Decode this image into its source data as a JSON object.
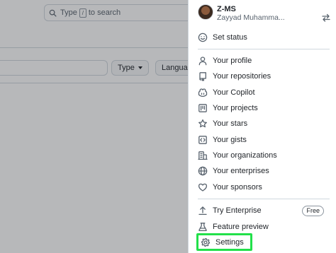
{
  "background": {
    "search_text_before": "Type",
    "search_key": "/",
    "search_text_after": "to search",
    "type_button_label": "Type",
    "language_button_label": "Languag"
  },
  "account_menu": {
    "username": "Z-MS",
    "full_name": "Zayyad Muhamma...",
    "switch_icon": "arrow-switch-icon",
    "items": [
      {
        "label": "Set status",
        "icon": "smiley-icon"
      },
      {
        "label": "Your profile",
        "icon": "person-icon"
      },
      {
        "label": "Your repositories",
        "icon": "repo-icon"
      },
      {
        "label": "Your Copilot",
        "icon": "copilot-icon"
      },
      {
        "label": "Your projects",
        "icon": "project-icon"
      },
      {
        "label": "Your stars",
        "icon": "star-icon"
      },
      {
        "label": "Your gists",
        "icon": "code-square-icon"
      },
      {
        "label": "Your organizations",
        "icon": "organization-icon"
      },
      {
        "label": "Your enterprises",
        "icon": "globe-icon"
      },
      {
        "label": "Your sponsors",
        "icon": "heart-icon"
      },
      {
        "label": "Try Enterprise",
        "icon": "upload-icon",
        "badge": "Free"
      },
      {
        "label": "Feature preview",
        "icon": "beaker-icon"
      },
      {
        "label": "Settings",
        "icon": "gear-icon",
        "highlighted": true
      }
    ]
  },
  "colors": {
    "highlight": "#22e04a",
    "text": "#1f2328",
    "muted": "#59636e",
    "border": "#d0d7de"
  }
}
